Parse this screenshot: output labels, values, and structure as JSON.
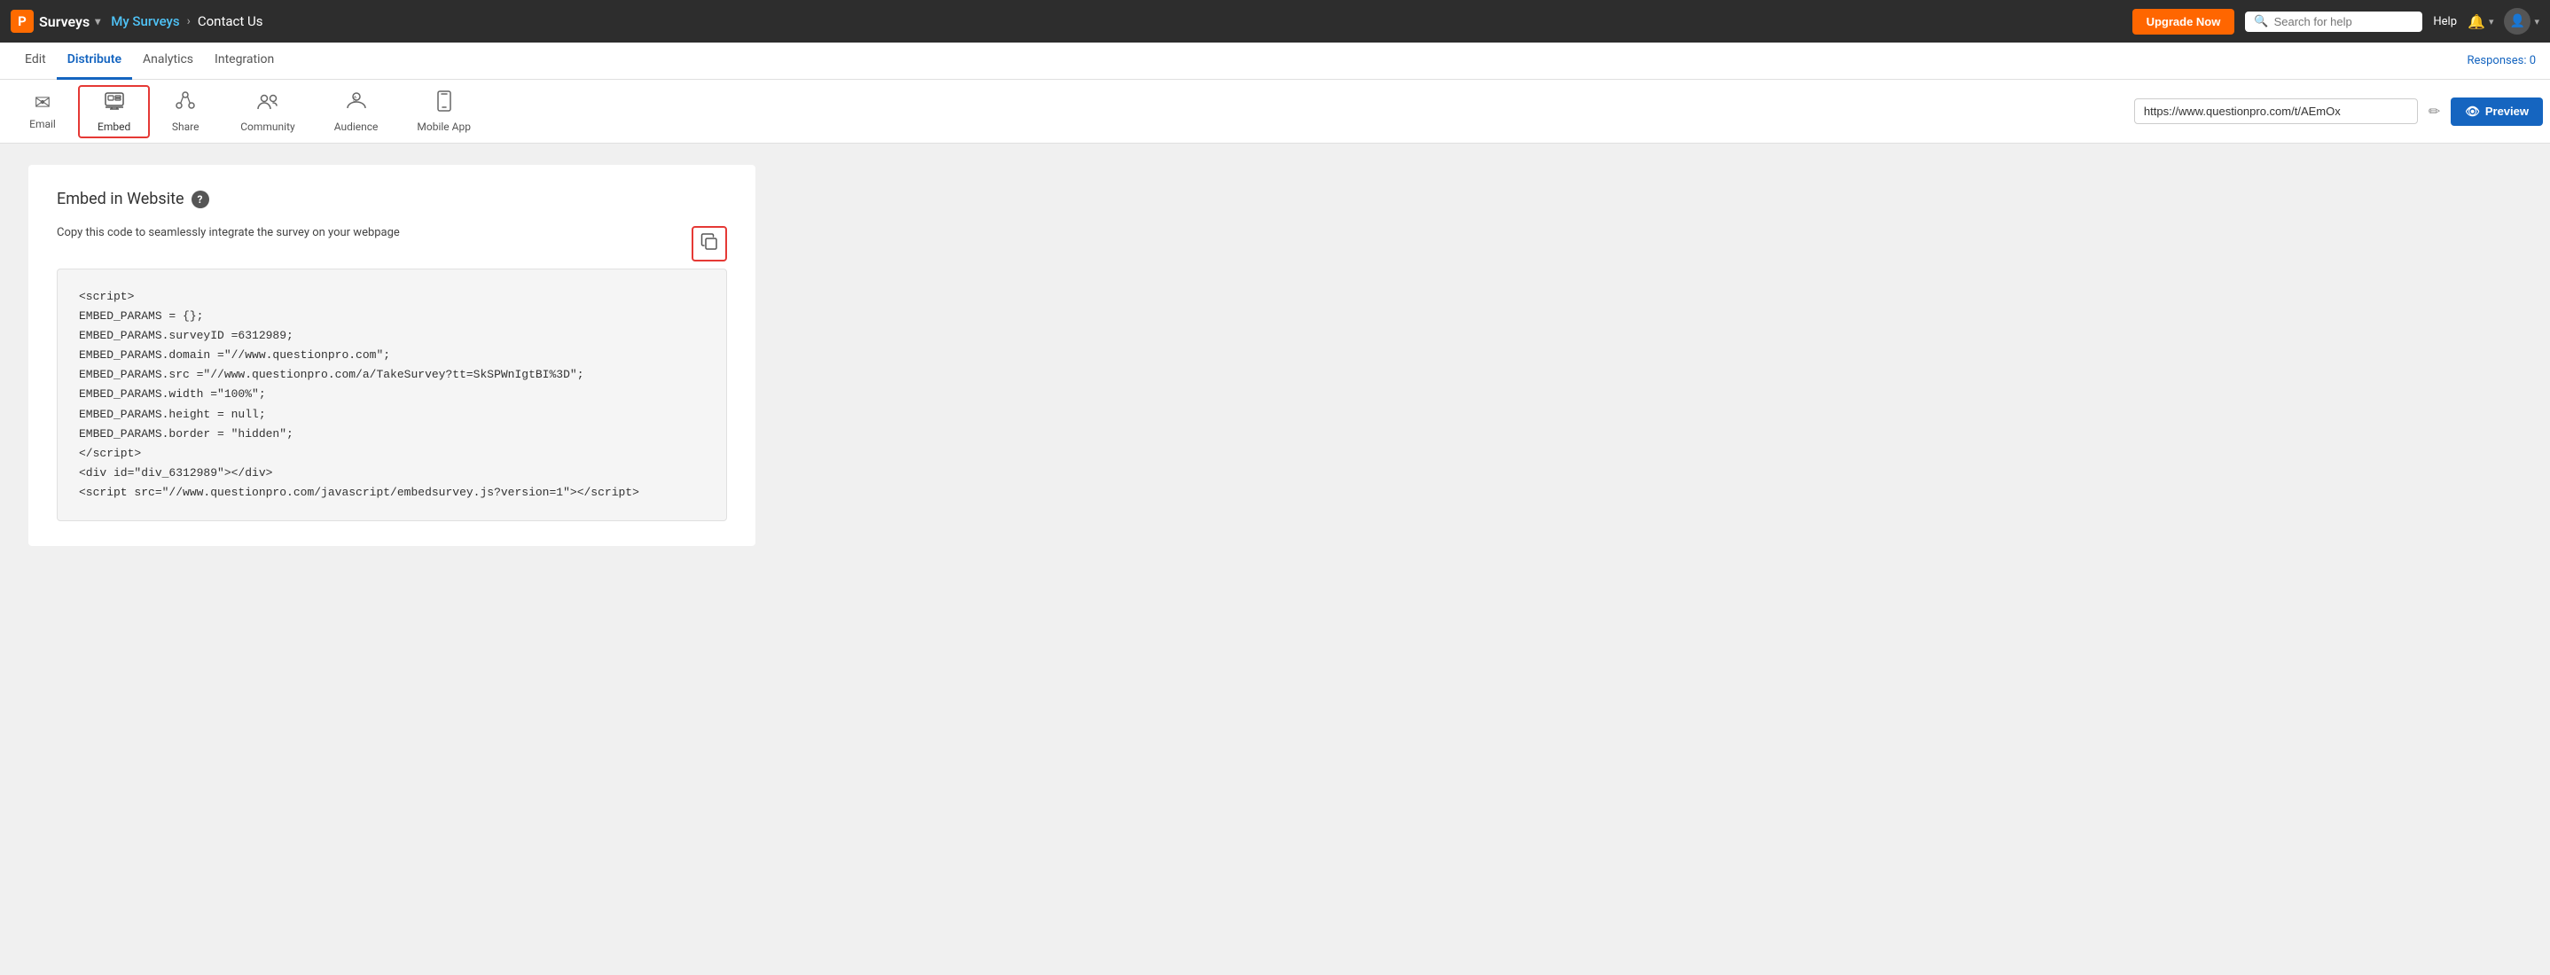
{
  "topNav": {
    "logo": "P",
    "appName": "Surveys",
    "breadcrumb": {
      "link": "My Surveys",
      "separator": "›",
      "current": "Contact Us"
    },
    "upgradeBtn": "Upgrade Now",
    "searchPlaceholder": "Search for help",
    "helpText": "Help",
    "responsesText": "Responses: 0"
  },
  "secondNav": {
    "tabs": [
      {
        "id": "edit",
        "label": "Edit",
        "active": false
      },
      {
        "id": "distribute",
        "label": "Distribute",
        "active": true
      },
      {
        "id": "analytics",
        "label": "Analytics",
        "active": false
      },
      {
        "id": "integration",
        "label": "Integration",
        "active": false
      }
    ]
  },
  "thirdNav": {
    "tools": [
      {
        "id": "email",
        "label": "Email",
        "icon": "✉",
        "active": false
      },
      {
        "id": "embed",
        "label": "Embed",
        "icon": "⊞",
        "active": true
      },
      {
        "id": "share",
        "label": "Share",
        "icon": "↗",
        "active": false
      },
      {
        "id": "community",
        "label": "Community",
        "icon": "👥",
        "active": false
      },
      {
        "id": "audience",
        "label": "Audience",
        "icon": "💰",
        "active": false
      },
      {
        "id": "mobileapp",
        "label": "Mobile App",
        "icon": "📱",
        "active": false
      }
    ],
    "urlValue": "https://www.questionpro.com/t/AEmOx",
    "previewBtn": "Preview"
  },
  "embedSection": {
    "title": "Embed in Website",
    "copyDescription": "Copy this code to seamlessly integrate the survey on your webpage",
    "codeBlock": "<script>\nEMBED_PARAMS = {};\nEMBED_PARAMS.surveyID =6312989;\nEMBED_PARAMS.domain =\"//www.questionpro.com\";\nEMBED_PARAMS.src =\"//www.questionpro.com/a/TakeSurvey?tt=SkSPWnIgtBI%3D\";\nEMBED_PARAMS.width =\"100%\";\nEMBED_PARAMS.height = null;\nEMBED_PARAMS.border = \"hidden\";\n<\\/script>\n<div id=\"div_6312989\"><\\/div>\n<script src=\"//www.questionpro.com/javascript/embedsurvey.js?version=1\"><\\/script>"
  }
}
